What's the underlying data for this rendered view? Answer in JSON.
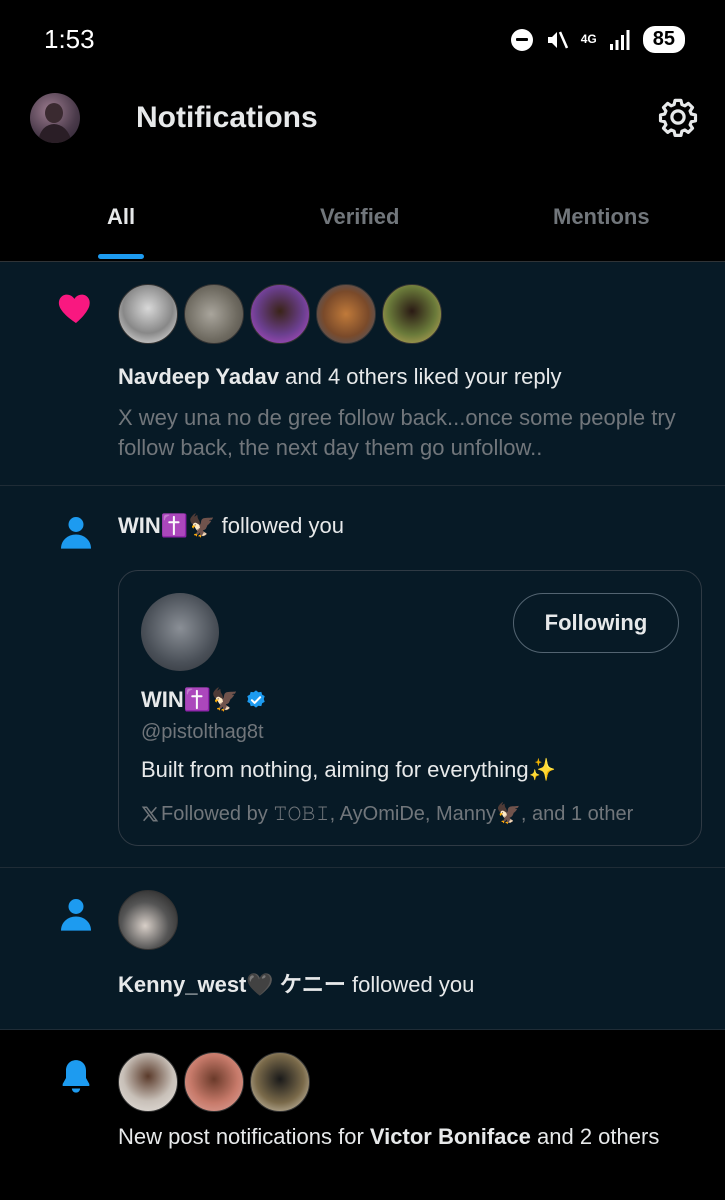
{
  "status_bar": {
    "time": "1:53",
    "network": "4G",
    "battery": "85"
  },
  "header": {
    "title": "Notifications"
  },
  "tabs": [
    {
      "label": "All",
      "active": true
    },
    {
      "label": "Verified",
      "active": false
    },
    {
      "label": "Mentions",
      "active": false
    }
  ],
  "notifications": [
    {
      "type_icon": "heart-icon",
      "actor": "Navdeep Yadav",
      "action": " and 4 others liked your reply",
      "snippet": "X wey una no de gree follow back...once some people try follow back, the next day them go unfollow.."
    },
    {
      "type_icon": "person-icon",
      "actor": "WIN✝️🦅",
      "action": " followed you",
      "card": {
        "name": "WIN✝️🦅",
        "handle": "@pistolthag8t",
        "bio": "Built from nothing, aiming for everything✨",
        "follow_label": "Following",
        "followed_by": "Followed by 𝚃𝙾𝙱𝙸, AyOmiDe, Manny🦅, and 1 other"
      }
    },
    {
      "type_icon": "person-icon",
      "actor": "Kenny_west🖤 ケニー",
      "action": " followed you"
    },
    {
      "type_icon": "bell-icon",
      "prefix": "New post notifications for ",
      "actor": "Victor Boniface",
      "action": " and 2 others"
    }
  ],
  "colors": {
    "accent": "#1d9bf0",
    "like": "#f91880",
    "background": "#071a26"
  }
}
